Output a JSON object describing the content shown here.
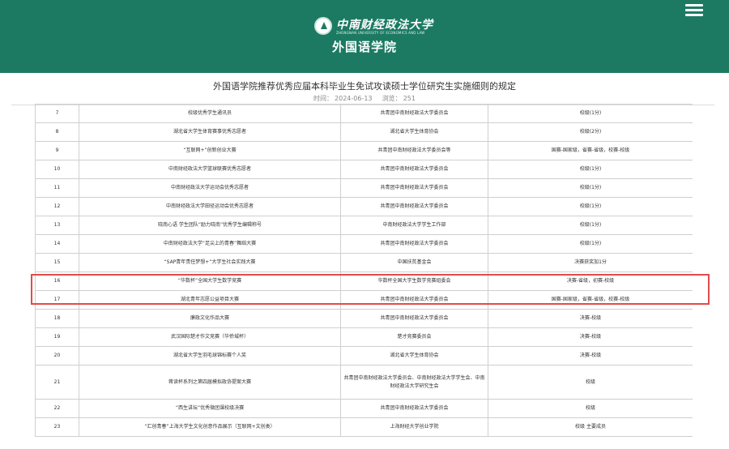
{
  "header": {
    "university_name": "中南财经政法大学",
    "university_en": "ZHONGNAN UNIVERSITY OF ECONOMICS AND LAW",
    "college": "外国语学院",
    "brand_color": "#1c7a63",
    "menu_icon": "hamburger-menu-icon"
  },
  "article": {
    "title": "外国语学院推荐优秀应届本科毕业生免试攻读硕士学位研究生实施细则的规定",
    "time_label": "时间：",
    "time": "2024-06-13",
    "views_label": "浏览：",
    "views": "251"
  },
  "table": {
    "rows": [
      {
        "no": "7",
        "name": "校级优秀学生通讯员",
        "org": "共青团中南财经政法大学委员会",
        "level": "校级(1分)"
      },
      {
        "no": "8",
        "name": "湖北省大学生体育赛事优秀志愿者",
        "org": "湖北省大学生体育协会",
        "level": "校级(2分)"
      },
      {
        "no": "9",
        "name": "“互联网+”创新创业大赛",
        "org": "共青团中南财经政法大学委员会等",
        "level": "国赛-国家级，省赛-省级，校赛-校级"
      },
      {
        "no": "10",
        "name": "中南财经政法大学篮球联赛优秀志愿者",
        "org": "共青团中南财经政法大学委员会",
        "level": "校级(1分)"
      },
      {
        "no": "11",
        "name": "中南财经政法大学运动会优秀志愿者",
        "org": "共青团中南财经政法大学委员会",
        "level": "校级(1分)"
      },
      {
        "no": "12",
        "name": "中南财经政法大学田径运动会优秀志愿者",
        "org": "共青团中南财经政法大学委员会",
        "level": "校级(1分)"
      },
      {
        "no": "13",
        "name": "晓南心语 学生团队“励力晓南”优秀学生编辑称号",
        "org": "中南财经政法大学学生工作部",
        "level": "校级(1分)"
      },
      {
        "no": "14",
        "name": "中南财经政法大学“足尖上的青春”舞蹈大赛",
        "org": "共青团中南财经政法大学委员会",
        "level": "校级(1分)"
      },
      {
        "no": "15",
        "name": "“SAP青年责任梦想+”大学生社会实践大赛",
        "org": "中国扶贫基金会",
        "level": "决赛获奖加1分"
      },
      {
        "no": "16",
        "name": "“华数杯”全国大学生数学竞赛",
        "org": "华数杯全国大学生数学竞赛组委会",
        "level": "决赛-省级，初赛-校级"
      },
      {
        "no": "17",
        "name": "湖北青年志愿公益项目大赛",
        "org": "共青团中南财经政法大学委员会",
        "level": "国赛-国家级，省赛-省级，校赛-校级"
      },
      {
        "no": "18",
        "name": "廉政文化作品大赛",
        "org": "共青团中南财经政法大学委员会",
        "level": "决赛-校级"
      },
      {
        "no": "19",
        "name": "武汉国际楚才作文竞赛（华侨城杯）",
        "org": "楚才竞赛委员会",
        "level": "决赛-校级"
      },
      {
        "no": "20",
        "name": "湖北省大学生羽毛球锦标赛个人奖",
        "org": "湖北省大学生体育协会",
        "level": "决赛-校级"
      },
      {
        "no": "21",
        "name": "蒋读杯系列之第四届模拟政协提案大赛",
        "org": "共青团中南财经政法大学委员会、中南财经政法大学学生会、中南财经政法大学研究生会",
        "level": "校级"
      },
      {
        "no": "22",
        "name": "“西生讲坛”优秀微团课校级决赛",
        "org": "共青团中南财经政法大学委员会",
        "level": "校级"
      },
      {
        "no": "23",
        "name": "“汇创青春”上海大学生文化创意作品展示（互联网+文创类）",
        "org": "上海财经大学创业学院",
        "level": "校级 主要成员"
      }
    ],
    "highlight_color": "#e24b4b"
  }
}
